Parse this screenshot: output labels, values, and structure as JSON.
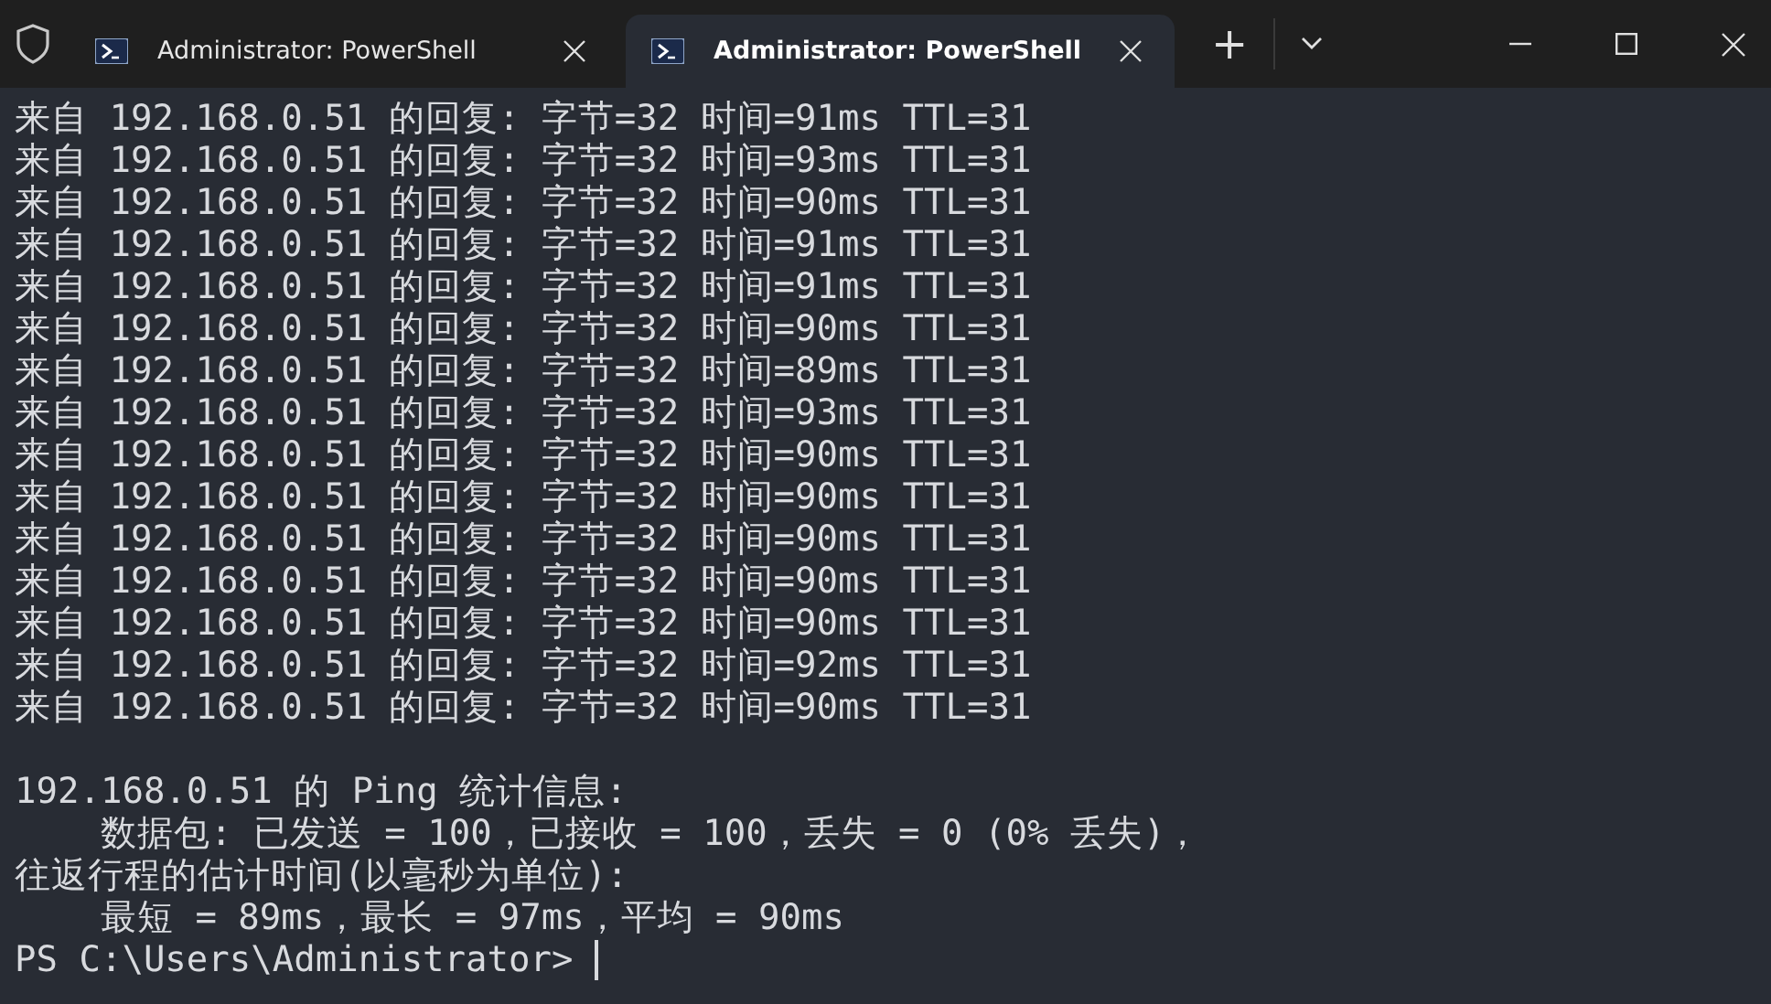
{
  "tabs": [
    {
      "title": "Administrator: PowerShell",
      "selected": false
    },
    {
      "title": "Administrator: PowerShell",
      "selected": true
    }
  ],
  "new_tab_button": "+",
  "terminal": {
    "output_lines": [
      "来自 192.168.0.51 的回复: 字节=32 时间=91ms TTL=31",
      "来自 192.168.0.51 的回复: 字节=32 时间=93ms TTL=31",
      "来自 192.168.0.51 的回复: 字节=32 时间=90ms TTL=31",
      "来自 192.168.0.51 的回复: 字节=32 时间=91ms TTL=31",
      "来自 192.168.0.51 的回复: 字节=32 时间=91ms TTL=31",
      "来自 192.168.0.51 的回复: 字节=32 时间=90ms TTL=31",
      "来自 192.168.0.51 的回复: 字节=32 时间=89ms TTL=31",
      "来自 192.168.0.51 的回复: 字节=32 时间=93ms TTL=31",
      "来自 192.168.0.51 的回复: 字节=32 时间=90ms TTL=31",
      "来自 192.168.0.51 的回复: 字节=32 时间=90ms TTL=31",
      "来自 192.168.0.51 的回复: 字节=32 时间=90ms TTL=31",
      "来自 192.168.0.51 的回复: 字节=32 时间=90ms TTL=31",
      "来自 192.168.0.51 的回复: 字节=32 时间=90ms TTL=31",
      "来自 192.168.0.51 的回复: 字节=32 时间=92ms TTL=31",
      "来自 192.168.0.51 的回复: 字节=32 时间=90ms TTL=31"
    ],
    "summary_lines": [
      "192.168.0.51 的 Ping 统计信息:",
      "    数据包: 已发送 = 100，已接收 = 100，丢失 = 0 (0% 丢失)，",
      "往返行程的估计时间(以毫秒为单位):",
      "    最短 = 89ms，最长 = 97ms，平均 = 90ms"
    ],
    "prompt": "PS C:\\Users\\Administrator> "
  }
}
